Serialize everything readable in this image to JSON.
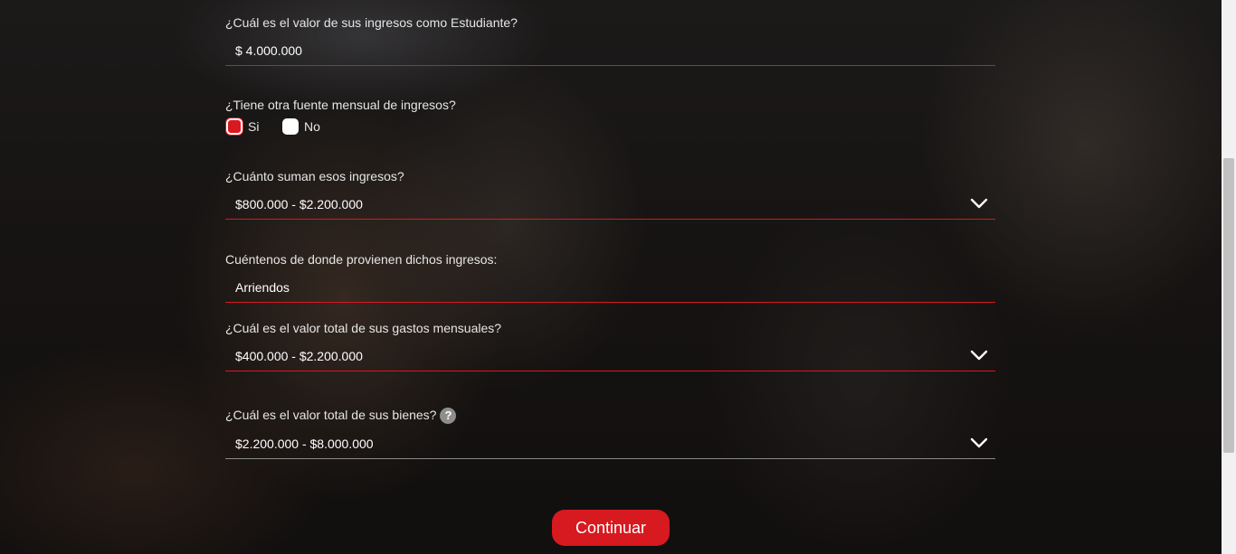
{
  "form": {
    "q_student_income": {
      "label": "¿Cuál es el valor de sus ingresos como Estudiante?",
      "value": "$ 4.000.000"
    },
    "q_other_income": {
      "label": "¿Tiene otra fuente mensual de ingresos?",
      "options": [
        {
          "label": "Si",
          "checked": true
        },
        {
          "label": "No",
          "checked": false
        }
      ]
    },
    "q_other_income_amount": {
      "label": "¿Cuánto suman esos ingresos?",
      "selected": "$800.000 - $2.200.000"
    },
    "q_income_source": {
      "label": "Cuéntenos de donde provienen dichos ingresos:",
      "value": "Arriendos"
    },
    "q_monthly_expenses": {
      "label": "¿Cuál es el valor total de sus gastos mensuales?",
      "selected": "$400.000 - $2.200.000"
    },
    "q_assets": {
      "label": "¿Cuál es el valor total de sus bienes?",
      "help": "?",
      "selected": "$2.200.000 - $8.000.000"
    },
    "continue_label": "Continuar"
  },
  "icons": {
    "dropdown": "chevron-down-icon",
    "help": "question-circle-icon"
  },
  "colors": {
    "accent": "#d71920",
    "text": "#e6e6e6",
    "inactive_line": "#8a8a8a"
  }
}
